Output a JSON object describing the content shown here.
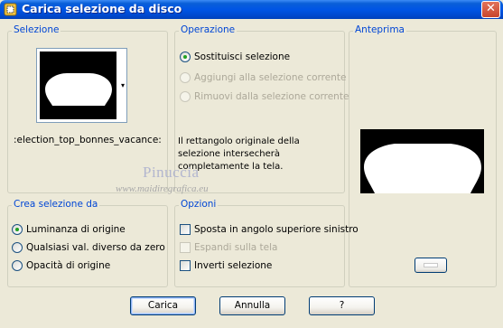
{
  "window": {
    "title": "Carica selezione da disco",
    "close_glyph": "✕"
  },
  "selection_group": {
    "legend": "Selezione",
    "selection_name": ":election_top_bonnes_vacance:",
    "dropdown_glyph": "▾"
  },
  "operation_group": {
    "legend": "Operazione",
    "options": [
      {
        "label": "Sostituisci selezione",
        "checked": true,
        "enabled": true
      },
      {
        "label": "Aggiungi alla selezione corrente",
        "checked": false,
        "enabled": false
      },
      {
        "label": "Rimuovi dalla selezione corrente",
        "checked": false,
        "enabled": false
      }
    ],
    "info_text": "Il rettangolo originale della selezione intersecherà completamente la tela."
  },
  "preview_group": {
    "legend": "Anteprima"
  },
  "create_group": {
    "legend": "Crea selezione da",
    "options": [
      {
        "label": "Luminanza di origine",
        "checked": true
      },
      {
        "label": "Qualsiasi val. diverso da zero",
        "checked": false
      },
      {
        "label": "Opacità di origine",
        "checked": false
      }
    ]
  },
  "options_group": {
    "legend": "Opzioni",
    "options": [
      {
        "label": "Sposta in angolo superiore sinistro",
        "checked": false,
        "enabled": true
      },
      {
        "label": "Espandi sulla tela",
        "checked": false,
        "enabled": false
      },
      {
        "label": "Inverti selezione",
        "checked": false,
        "enabled": true
      }
    ]
  },
  "watermark": {
    "line1": "Pinuccia",
    "line2": "www.maidiregrafica.eu"
  },
  "buttons": {
    "load": "Carica",
    "cancel": "Annulla",
    "help": "?"
  },
  "colors": {
    "accent": "#0046d5",
    "titlebar": "#0055e5",
    "face": "#ece9d8"
  }
}
